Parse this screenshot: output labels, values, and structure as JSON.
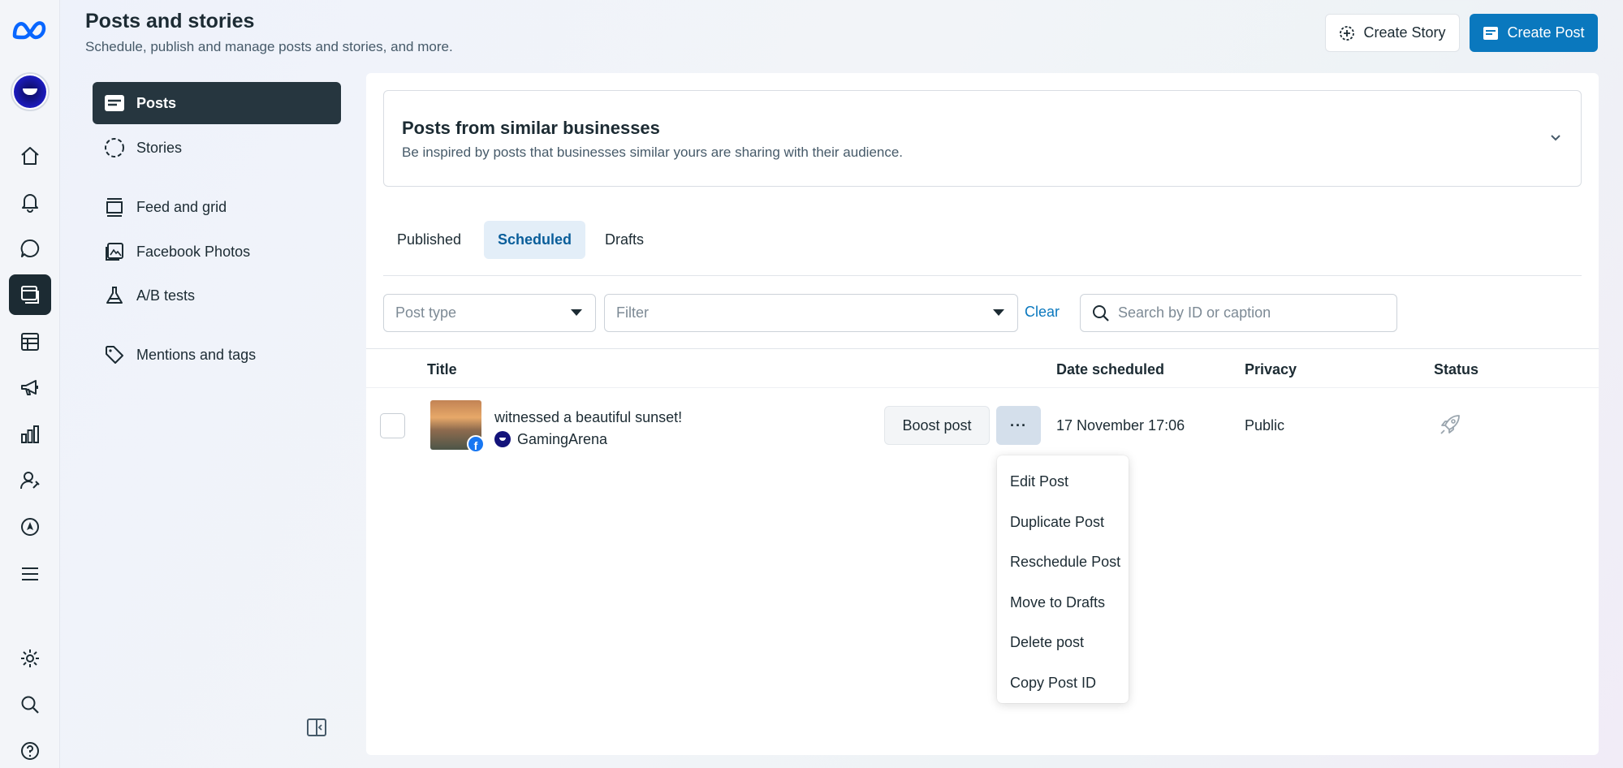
{
  "header": {
    "title": "Posts and stories",
    "subtitle": "Schedule, publish and manage posts and stories, and more.",
    "create_story_label": "Create Story",
    "create_post_label": "Create Post"
  },
  "rail": {
    "icons": [
      "home-icon",
      "notifications-icon",
      "messages-icon",
      "posts-icon",
      "content-table-icon",
      "ads-megaphone-icon",
      "insights-icon",
      "audience-icon",
      "planner-icon",
      "menu-icon",
      "settings-icon",
      "search-icon",
      "help-icon"
    ],
    "active": "posts-icon"
  },
  "subnav": {
    "items": [
      {
        "label": "Posts",
        "icon": "posts-icon",
        "active": true
      },
      {
        "label": "Stories",
        "icon": "stories-icon"
      },
      {
        "label": "Feed and grid",
        "icon": "feed-grid-icon"
      },
      {
        "label": "Facebook Photos",
        "icon": "photos-icon"
      },
      {
        "label": "A/B tests",
        "icon": "flask-icon"
      },
      {
        "label": "Mentions and tags",
        "icon": "tag-icon"
      }
    ]
  },
  "similar": {
    "title": "Posts from similar businesses",
    "description": "Be inspired by posts that businesses similar yours are sharing with their audience."
  },
  "tabs": [
    {
      "label": "Published"
    },
    {
      "label": "Scheduled",
      "active": true
    },
    {
      "label": "Drafts"
    }
  ],
  "filters": {
    "post_type_placeholder": "Post type",
    "filter_placeholder": "Filter",
    "clear_label": "Clear",
    "search_placeholder": "Search by ID or caption"
  },
  "table": {
    "columns": [
      "Title",
      "Date scheduled",
      "Privacy",
      "Status"
    ],
    "rows": [
      {
        "caption": "witnessed a beautiful sunset!",
        "page": "GamingArena",
        "boost_label": "Boost post",
        "more_label": "···",
        "date": "17 November 17:06",
        "privacy": "Public",
        "status_icon": "rocket-icon"
      }
    ]
  },
  "menu": {
    "items": [
      "Edit Post",
      "Duplicate Post",
      "Reschedule Post",
      "Move to Drafts",
      "Delete post",
      "Copy Post ID"
    ]
  },
  "colors": {
    "accent": "#0a78be",
    "active_nav": "#26363f",
    "active_tab_bg": "#e3eef8"
  }
}
